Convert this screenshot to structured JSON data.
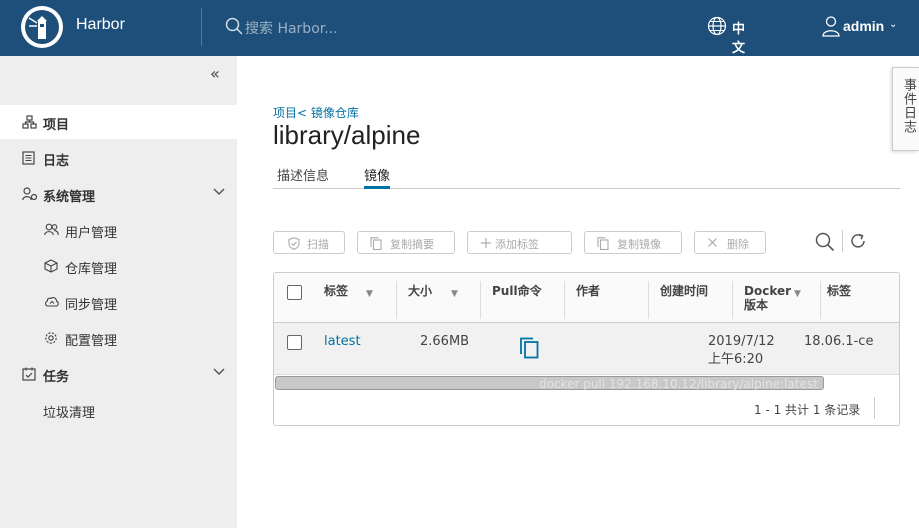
{
  "header": {
    "brand": "Harbor",
    "search_placeholder": "搜索 Harbor...",
    "language": "中文简体",
    "user": "admin",
    "colors": {
      "header_bg": "#1d4f7a",
      "accent": "#0072a3"
    }
  },
  "sidebar": {
    "items": [
      {
        "label": "项目",
        "icon": "projects-icon",
        "active": true
      },
      {
        "label": "日志",
        "icon": "log-icon"
      },
      {
        "label": "系统管理",
        "icon": "admin-icon",
        "expandable": true,
        "children": [
          {
            "label": "用户管理",
            "icon": "users-icon"
          },
          {
            "label": "仓库管理",
            "icon": "registry-icon"
          },
          {
            "label": "同步管理",
            "icon": "replication-icon"
          },
          {
            "label": "配置管理",
            "icon": "config-icon"
          }
        ]
      },
      {
        "label": "任务",
        "icon": "tasks-icon",
        "expandable": true,
        "children": [
          {
            "label": "垃圾清理"
          }
        ]
      }
    ]
  },
  "main": {
    "breadcrumb": "项目< 镜像仓库",
    "title": "library/alpine",
    "tabs": [
      {
        "label": "描述信息",
        "active": false
      },
      {
        "label": "镜像",
        "active": true
      }
    ],
    "toolbar": {
      "scan": "扫描",
      "copy_digest": "复制摘要",
      "add_label": "添加标签",
      "copy_image": "复制镜像",
      "delete": "删除"
    },
    "grid": {
      "columns": [
        "标签",
        "大小",
        "Pull命令",
        "作者",
        "创建时间",
        "Docker\n版本",
        "标签"
      ],
      "rows": [
        {
          "tag": "latest",
          "size": "2.66MB",
          "author": "",
          "created_line1": "2019/7/12",
          "created_line2": "上午6:20",
          "docker_version": "18.06.1-ce"
        }
      ],
      "hidden_pull_command": "docker pull 192.168.10.12/library/alpine:latest",
      "footer": "1 - 1 共计 1 条记录"
    }
  },
  "event_log": "事件日志"
}
